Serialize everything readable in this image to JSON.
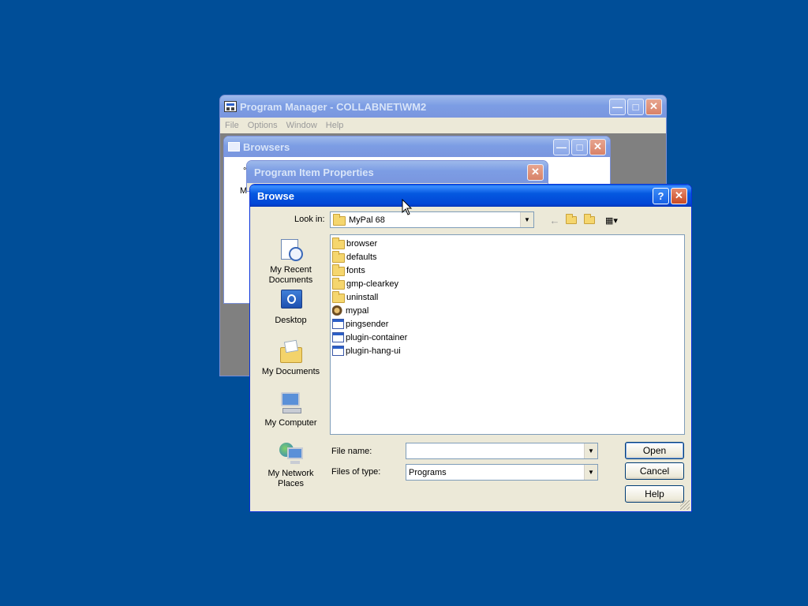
{
  "program_manager": {
    "title": "Program Manager - COLLABNET\\WM2",
    "menu": [
      "File",
      "Options",
      "Window",
      "Help"
    ]
  },
  "browsers_window": {
    "title": "Browsers",
    "partial_text_1": "°",
    "partial_text_2": "M"
  },
  "properties_window": {
    "title": "Program Item Properties"
  },
  "browse_dialog": {
    "title": "Browse",
    "look_in_label": "Look in:",
    "look_in_value": "MyPal 68",
    "places": [
      {
        "label": "My Recent\nDocuments",
        "icon": "recent-documents-icon"
      },
      {
        "label": "Desktop",
        "icon": "desktop-icon"
      },
      {
        "label": "My Documents",
        "icon": "my-documents-icon"
      },
      {
        "label": "My Computer",
        "icon": "my-computer-icon"
      },
      {
        "label": "My Network\nPlaces",
        "icon": "network-places-icon"
      }
    ],
    "files": [
      {
        "name": "browser",
        "type": "folder"
      },
      {
        "name": "defaults",
        "type": "folder"
      },
      {
        "name": "fonts",
        "type": "folder"
      },
      {
        "name": "gmp-clearkey",
        "type": "folder"
      },
      {
        "name": "uninstall",
        "type": "folder"
      },
      {
        "name": "mypal",
        "type": "mypal"
      },
      {
        "name": "pingsender",
        "type": "exe"
      },
      {
        "name": "plugin-container",
        "type": "exe"
      },
      {
        "name": "plugin-hang-ui",
        "type": "exe"
      }
    ],
    "file_name_label": "File name:",
    "file_name_value": "",
    "files_of_type_label": "Files of type:",
    "files_of_type_value": "Programs",
    "buttons": {
      "open": "Open",
      "cancel": "Cancel",
      "help": "Help"
    }
  }
}
